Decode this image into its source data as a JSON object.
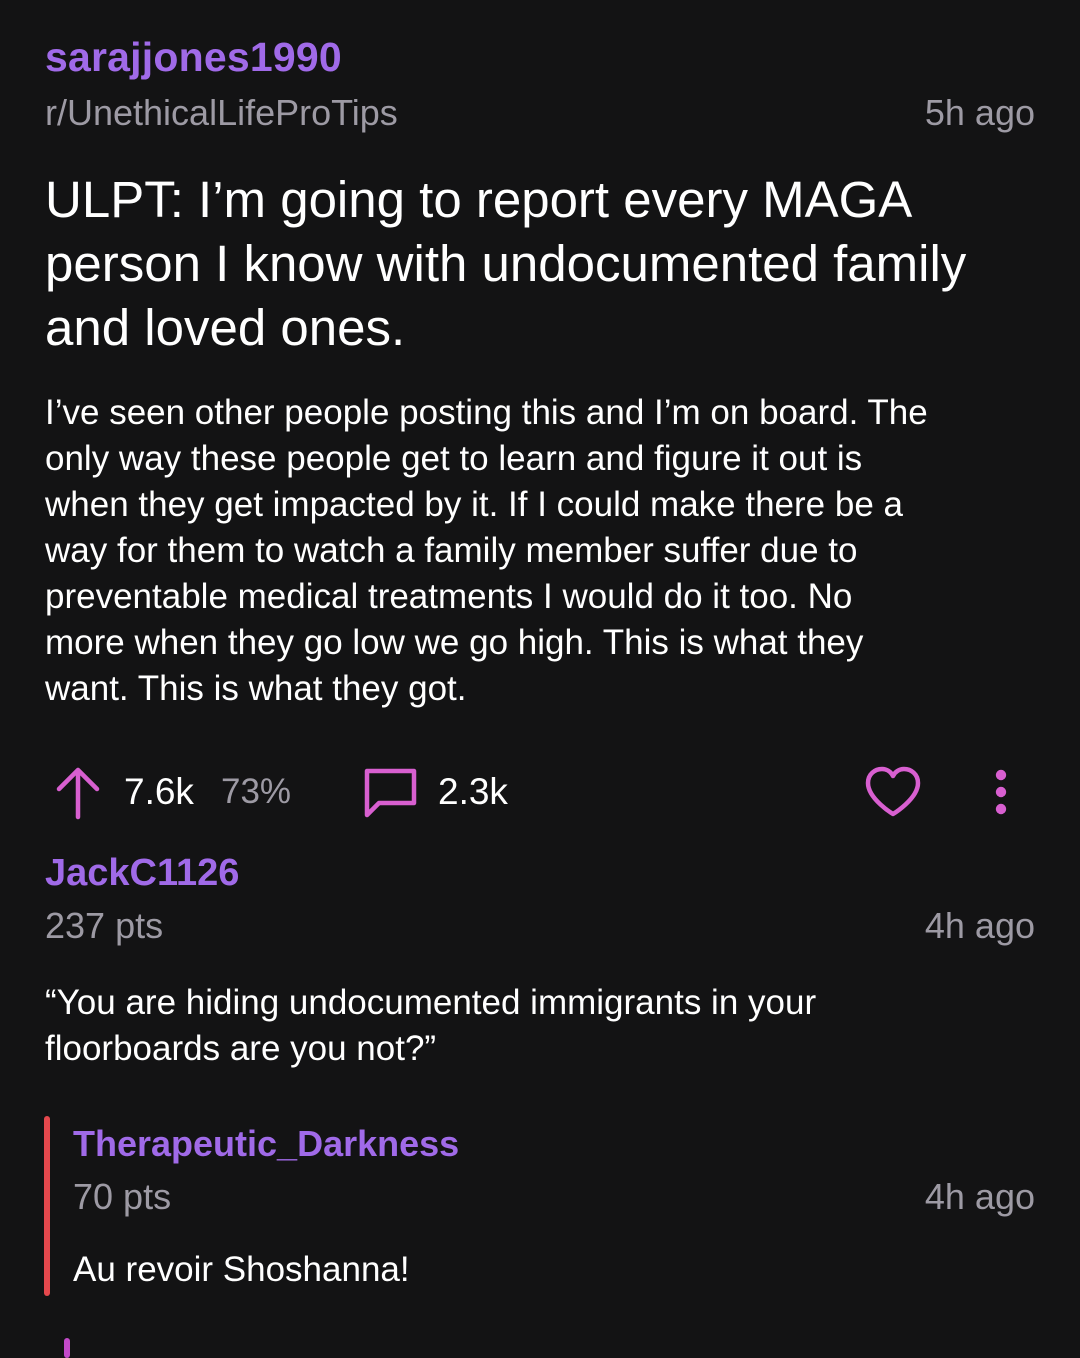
{
  "post": {
    "author": "sarajjones1990",
    "subreddit": "r/UnethicalLifeProTips",
    "time": "5h ago",
    "title": "ULPT: I’m going to report every MAGA person I know with undocumented family and loved ones.",
    "body_lines": [
      "I’ve seen other people posting this and I’m on board. The",
      "only way these people get to learn and figure it out is",
      "when they get impacted by it. If I could make there be a",
      "way for them to watch a family member suffer due to",
      "preventable medical treatments I would do it too. No",
      "more when they go low we go high. This is what they",
      "want. This is what they got."
    ],
    "upvotes": "7.6k",
    "upvote_ratio": "73%",
    "comments": "2.3k"
  },
  "comments": [
    {
      "author": "JackC1126",
      "points": "237 pts",
      "time": "4h ago",
      "text_lines": [
        "“You are hiding undocumented immigrants in your",
        "floorboards are you not?”"
      ]
    },
    {
      "author": "Therapeutic_Darkness",
      "points": "70 pts",
      "time": "4h ago",
      "text": "Au revoir Shoshanna!"
    }
  ],
  "icons": {
    "upvote": "arrow-up-icon",
    "comment": "comment-bubble-icon",
    "save": "heart-icon",
    "more": "more-vertical-icon"
  },
  "colors": {
    "background": "#131314",
    "username": "#a06ae8",
    "icon_accent": "#d85fd0",
    "muted_text": "#9d9aa4",
    "reply_bar": "#e5484d"
  }
}
